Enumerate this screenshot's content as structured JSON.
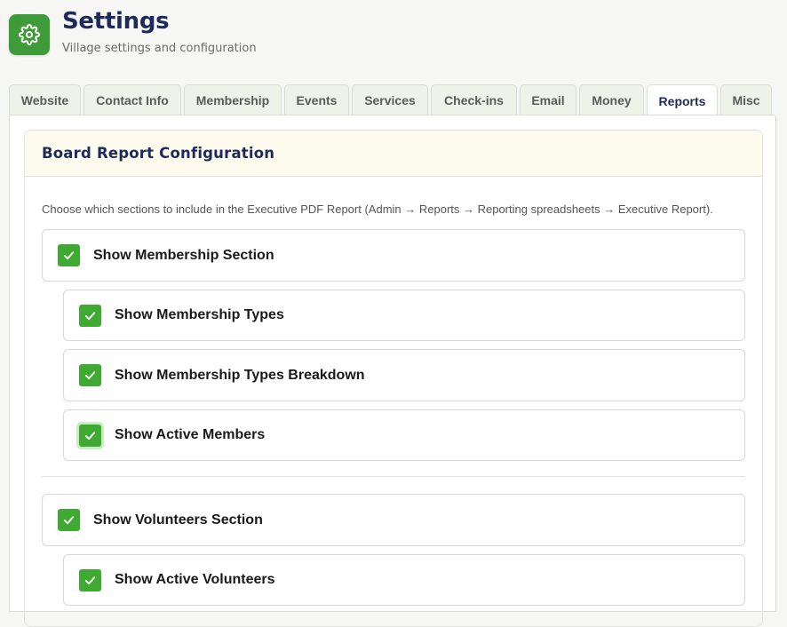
{
  "header": {
    "title": "Settings",
    "subtitle": "Village settings and configuration",
    "logo_icon": "gear-icon",
    "accent_color": "#3f9b3a"
  },
  "tabs": [
    {
      "label": "Website",
      "active": false
    },
    {
      "label": "Contact Info",
      "active": false
    },
    {
      "label": "Membership",
      "active": false
    },
    {
      "label": "Events",
      "active": false
    },
    {
      "label": "Services",
      "active": false
    },
    {
      "label": "Check-ins",
      "active": false
    },
    {
      "label": "Email",
      "active": false
    },
    {
      "label": "Money",
      "active": false
    },
    {
      "label": "Reports",
      "active": true
    },
    {
      "label": "Misc",
      "active": false
    }
  ],
  "card": {
    "title": "Board Report Configuration",
    "description": "Choose which sections to include in the Executive PDF Report (Admin → Reports → Reporting spreadsheets → Executive Report)."
  },
  "options": [
    {
      "label": "Show Membership Section",
      "checked": true,
      "level": 0
    },
    {
      "label": "Show Membership Types",
      "checked": true,
      "level": 1
    },
    {
      "label": "Show Membership Types Breakdown",
      "checked": true,
      "level": 1
    },
    {
      "label": "Show Active Members",
      "checked": true,
      "level": 1
    },
    {
      "label": "Show Volunteers Section",
      "checked": true,
      "level": 0
    },
    {
      "label": "Show Active Volunteers",
      "checked": true,
      "level": 1
    }
  ],
  "colors": {
    "checkbox": "#3faa32",
    "title": "#1e2a5a"
  }
}
